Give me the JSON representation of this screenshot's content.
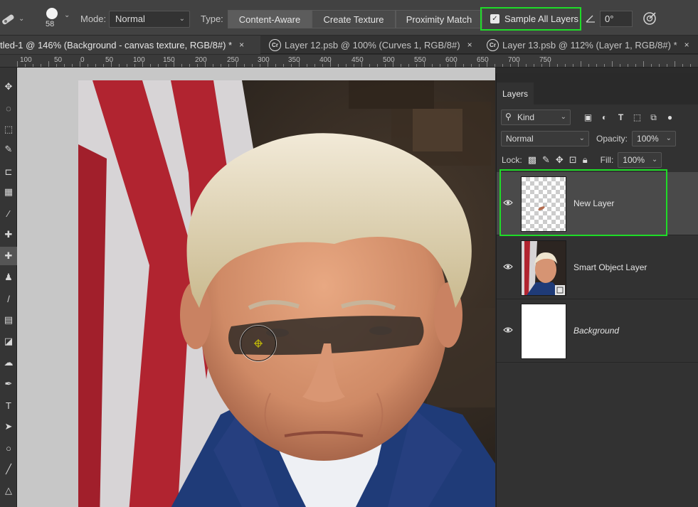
{
  "options_bar": {
    "brush_size": "58",
    "mode_label": "Mode:",
    "mode_value": "Normal",
    "type_label": "Type:",
    "type_buttons": [
      "Content-Aware",
      "Create Texture",
      "Proximity Match"
    ],
    "sample_all_layers_label": "Sample All Layers",
    "sample_all_layers_checked": true,
    "angle_value": "0°",
    "highlight_color": "#1fdc28"
  },
  "tabs": [
    {
      "label": "tled-1 @ 146% (Background - canvas texture, RGB/8#) *",
      "close": "×",
      "cr": false
    },
    {
      "label": "Layer 12.psb @ 100% (Curves 1, RGB/8#)",
      "close": "×",
      "cr": true
    },
    {
      "label": "Layer 13.psb @ 112% (Layer 1, RGB/8#) *",
      "close": "×",
      "cr": true
    }
  ],
  "cr_badge": "Cr",
  "ruler": [
    "100",
    "50",
    "0",
    "50",
    "100",
    "150",
    "200",
    "250",
    "300",
    "350",
    "400",
    "450",
    "500",
    "550",
    "600",
    "650",
    "700",
    "750"
  ],
  "layers_panel": {
    "tab_label": "Layers",
    "filter_kind": "Kind",
    "blend_mode": "Normal",
    "opacity_label": "Opacity:",
    "opacity_value": "100%",
    "lock_label": "Lock:",
    "fill_label": "Fill:",
    "fill_value": "100%",
    "layers": [
      {
        "name": "New Layer",
        "selected": true,
        "italic": false
      },
      {
        "name": "Smart Object Layer",
        "selected": false,
        "italic": false
      },
      {
        "name": "Background",
        "selected": false,
        "italic": true
      }
    ]
  }
}
